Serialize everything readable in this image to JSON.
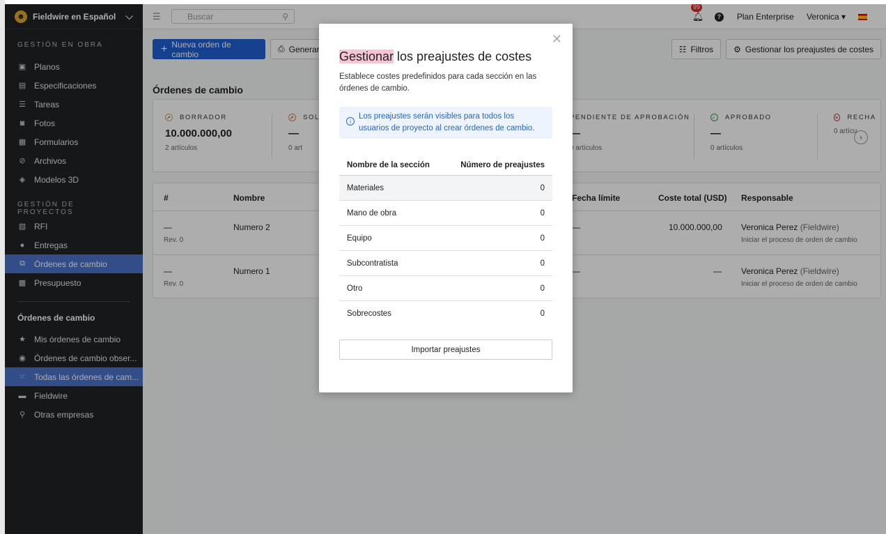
{
  "sidebar": {
    "workspace": "Fieldwire en Español",
    "section_obra": "GESTIÓN EN OBRA",
    "obra_items": [
      {
        "label": "Planos",
        "icon": "image-icon"
      },
      {
        "label": "Especificaciones",
        "icon": "book-icon"
      },
      {
        "label": "Tareas",
        "icon": "list-icon"
      },
      {
        "label": "Fotos",
        "icon": "camera-icon"
      },
      {
        "label": "Formularios",
        "icon": "clipboard-icon"
      },
      {
        "label": "Archivos",
        "icon": "paperclip-icon"
      },
      {
        "label": "Modelos 3D",
        "icon": "cube-icon"
      }
    ],
    "section_proyectos": "GESTIÓN DE PROYECTOS",
    "proyecto_items": [
      {
        "label": "RFI",
        "icon": "question-doc-icon"
      },
      {
        "label": "Entregas",
        "icon": "person-icon"
      },
      {
        "label": "Órdenes de cambio",
        "icon": "change-order-icon"
      },
      {
        "label": "Presupuesto",
        "icon": "calculator-icon"
      }
    ],
    "sub_title": "Órdenes de cambio",
    "sub_items": [
      {
        "label": "Mis órdenes de cambio",
        "icon": "star-icon"
      },
      {
        "label": "Órdenes de cambio obser...",
        "icon": "eye-icon"
      },
      {
        "label": "Todas las órdenes de cam...",
        "icon": "grid-icon"
      },
      {
        "label": "Fieldwire",
        "icon": "briefcase-icon"
      },
      {
        "label": "Otras empresas",
        "icon": "org-chart-icon"
      }
    ]
  },
  "topbar": {
    "search_placeholder": "Buscar",
    "notification_count": "99",
    "plan": "Plan Enterprise",
    "user": "Veronica ▾"
  },
  "toolbar": {
    "new_label": "Nueva orden de cambio",
    "generate_label": "Generar",
    "filters_label": "Filtros",
    "manage_label": "Gestionar los preajustes de costes"
  },
  "page_title": "Órdenes de cambio",
  "stats": [
    {
      "label": "BORRADOR",
      "value": "10.000.000,00",
      "count": "2 artículos"
    },
    {
      "label": "SOL",
      "value": "—",
      "count": "0 art"
    },
    {
      "label": "PENDIENTE DE APROBACIÓN",
      "value": "—",
      "count": "0 artículos"
    },
    {
      "label": "APROBADO",
      "value": "—",
      "count": "0 artículos"
    },
    {
      "label": "RECHA",
      "value": "",
      "count": "0 artícu"
    }
  ],
  "table": {
    "headers": {
      "num": "#",
      "name": "Nombre",
      "due": "Fecha límite",
      "cost": "Coste total (USD)",
      "owner": "Responsable"
    },
    "rows": [
      {
        "num": "—",
        "rev": "Rev. 0",
        "name": "Numero 2",
        "due": "—",
        "cost": "10.000.000,00",
        "owner": "Veronica Perez",
        "company": "(Fieldwire)",
        "note": "Iniciar el proceso de orden de cambio"
      },
      {
        "num": "—",
        "rev": "Rev. 0",
        "name": "Numero 1",
        "due": "—",
        "cost": "—",
        "owner": "Veronica Perez",
        "company": "(Fieldwire)",
        "note": "Iniciar el proceso de orden de cambio"
      }
    ]
  },
  "modal": {
    "title_highlight": "Gestionar",
    "title_rest": " los preajustes de costes",
    "description": "Establece costes predefinidos para cada sección en las órdenes de cambio.",
    "info": "Los preajustes serán visibles para todos los usuarios de proyecto al crear órdenes de cambio.",
    "col_section": "Nombre de la sección",
    "col_count": "Número de preajustes",
    "rows": [
      {
        "name": "Materiales",
        "count": "0"
      },
      {
        "name": "Mano de obra",
        "count": "0"
      },
      {
        "name": "Equipo",
        "count": "0"
      },
      {
        "name": "Subcontratista",
        "count": "0"
      },
      {
        "name": "Otro",
        "count": "0"
      },
      {
        "name": "Sobrecostes",
        "count": "0"
      }
    ],
    "import_label": "Importar preajustes"
  }
}
